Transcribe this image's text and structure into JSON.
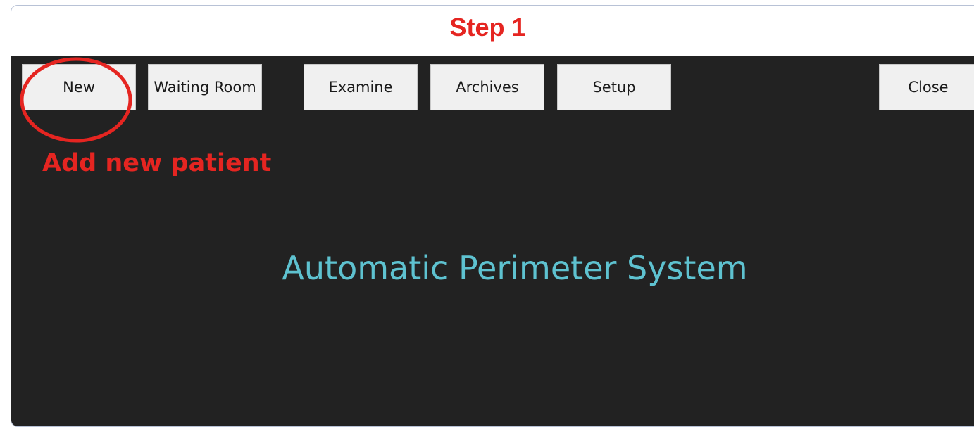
{
  "annotation": {
    "step_title": "Step 1",
    "callout_text": "Add new patient",
    "highlight_color": "#e52521"
  },
  "app": {
    "title": "Automatic Perimeter System",
    "background_color": "#222222",
    "title_color": "#5ec2d0"
  },
  "toolbar": {
    "new_label": "New",
    "waiting_room_label": "Waiting Room",
    "examine_label": "Examine",
    "archives_label": "Archives",
    "setup_label": "Setup",
    "close_label": "Close"
  }
}
